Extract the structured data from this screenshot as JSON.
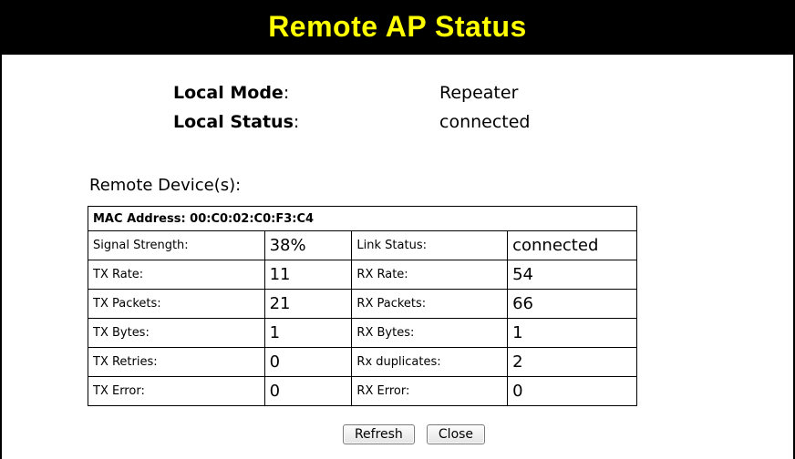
{
  "header": {
    "title": "Remote AP Status"
  },
  "local": {
    "mode_label": "Local Mode",
    "mode_value": "Repeater",
    "status_label": "Local Status",
    "status_value": "connected",
    "colon": ":"
  },
  "section_label": "Remote Device(s):",
  "device": {
    "mac_line": "MAC Address: 00:C0:02:C0:F3:C4",
    "rows": [
      {
        "k1": "Signal Strength:",
        "v1": "38%",
        "k2": "Link Status:",
        "v2": "connected"
      },
      {
        "k1": "TX Rate:",
        "v1": "11",
        "k2": "RX Rate:",
        "v2": "54"
      },
      {
        "k1": "TX Packets:",
        "v1": "21",
        "k2": "RX Packets:",
        "v2": "66"
      },
      {
        "k1": "TX Bytes:",
        "v1": "1",
        "k2": "RX Bytes:",
        "v2": "1"
      },
      {
        "k1": "TX Retries:",
        "v1": "0",
        "k2": "Rx duplicates:",
        "v2": "2"
      },
      {
        "k1": "TX Error:",
        "v1": "0",
        "k2": "RX Error:",
        "v2": "0"
      }
    ]
  },
  "buttons": {
    "refresh": "Refresh",
    "close": "Close"
  },
  "colors": {
    "title_bg": "#000000",
    "title_text": "#ffff00"
  }
}
